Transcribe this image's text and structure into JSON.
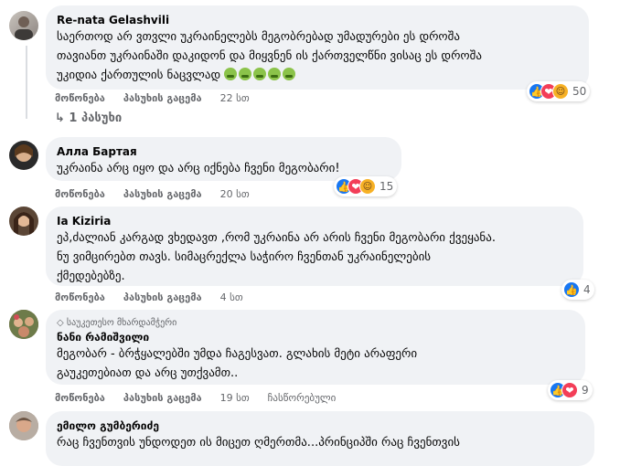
{
  "comments": [
    {
      "author": "Re-nata Gelashvili",
      "lines": [
        "საერთოდ არ ვთვლი უკრაინელებს მეგობრებად უმადურები ეს დროშა",
        "თავიანთ უკრაინაში დაკიდონ და მიყვნენ ის ქართველწნი ვისაც ეს დროშა",
        "უკიდია ქართულის ნაცვლად"
      ],
      "emoji_names": [
        "nauseated-face",
        "nauseated-face",
        "nauseated-face",
        "nauseated-face",
        "nauseated-face"
      ],
      "like": "მოწონება",
      "reply": "პასუხის გაცემა",
      "time": "22 სთ",
      "reaction_count": "50",
      "reactions": [
        "like",
        "love",
        "haha"
      ]
    },
    {
      "author": "Алла Бартая",
      "lines": [
        "უკრაინა არც იყო და არც იქნება ჩვენი მეგობარი!"
      ],
      "like": "მოწონება",
      "reply": "პასუხის გაცემა",
      "time": "20 სთ",
      "reaction_count": "15",
      "reactions": [
        "like",
        "love",
        "haha"
      ]
    },
    {
      "author": "Ia Kiziria",
      "lines": [
        "ეპ,ძალიან კარგად ვხედავთ ,რომ უკრაინა არ არის ჩვენი მეგობარი ქვეყანა.",
        "ნუ ვიმცირებთ თავს. სიმაცრექლა საჭირო ჩვენთან უკრაინელების",
        "ქმედებებზე."
      ],
      "like": "მოწონება",
      "reply": "პასუხის გაცემა",
      "time": "4 სთ",
      "reaction_count": "4",
      "reactions": [
        "like"
      ]
    },
    {
      "badge": "საუკეთესო მხარდამჭერი",
      "author": "ნანი რამიშვილი",
      "lines": [
        "მეგობარ - ბრჭყალებში უმდა ჩაგესვათ. გლახის მეტი არაფერი",
        "გაუკეთებიათ და არც უთქვამთ.."
      ],
      "like": "მოწონება",
      "reply": "პასუხის გაცემა",
      "time": "19 სთ",
      "edited": "ჩასწორებული",
      "reaction_count": "9",
      "reactions": [
        "like",
        "love"
      ]
    },
    {
      "author": "ემილო გუმბერიძე",
      "lines": [
        "რაც ჩვენთვის უნდოდეთ ის მიცეთ ღმერთმა...პრინციპში რაც ჩვენთვის"
      ]
    }
  ],
  "reply_link": "↳ 1 პასუხი"
}
